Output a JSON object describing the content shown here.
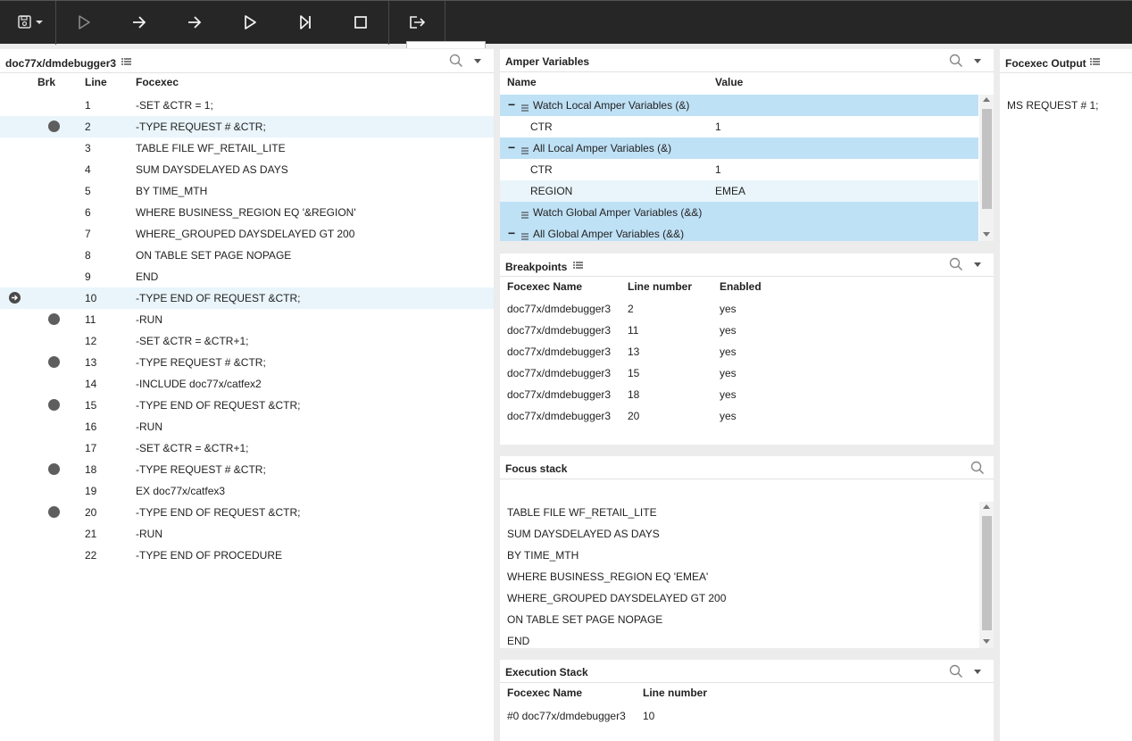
{
  "toolbar": {
    "buttons": [
      {
        "name": "save-menu",
        "icon": "save-icon"
      },
      {
        "name": "run",
        "icon": "play-outline-icon"
      },
      {
        "name": "step-over",
        "icon": "arrow-right-icon"
      },
      {
        "name": "step-into",
        "icon": "arrow-right-icon"
      },
      {
        "name": "continue",
        "icon": "play-icon"
      },
      {
        "name": "step-to-end",
        "icon": "skip-next-icon"
      },
      {
        "name": "stop",
        "icon": "stop-icon"
      },
      {
        "name": "exit",
        "icon": "exit-icon"
      }
    ]
  },
  "source": {
    "title": "doc77x/dmdebugger3",
    "headers": {
      "brk": "Brk",
      "line": "Line",
      "focexec": "Focexec"
    },
    "lines": [
      {
        "num": "1",
        "code": "-SET &CTR = 1;",
        "bp": false,
        "current": false,
        "hl": false
      },
      {
        "num": "2",
        "code": "-TYPE REQUEST # &CTR;",
        "bp": true,
        "current": false,
        "hl": true
      },
      {
        "num": "3",
        "code": "TABLE FILE WF_RETAIL_LITE",
        "bp": false,
        "current": false,
        "hl": false
      },
      {
        "num": "4",
        "code": "SUM DAYSDELAYED AS DAYS",
        "bp": false,
        "current": false,
        "hl": false
      },
      {
        "num": "5",
        "code": "BY TIME_MTH",
        "bp": false,
        "current": false,
        "hl": false
      },
      {
        "num": "6",
        "code": "WHERE BUSINESS_REGION EQ '&REGION'",
        "bp": false,
        "current": false,
        "hl": false
      },
      {
        "num": "7",
        "code": "WHERE_GROUPED DAYSDELAYED GT 200",
        "bp": false,
        "current": false,
        "hl": false
      },
      {
        "num": "8",
        "code": "ON TABLE SET PAGE NOPAGE",
        "bp": false,
        "current": false,
        "hl": false
      },
      {
        "num": "9",
        "code": "END",
        "bp": false,
        "current": false,
        "hl": false
      },
      {
        "num": "10",
        "code": "-TYPE END OF REQUEST &CTR;",
        "bp": false,
        "current": true,
        "hl": true
      },
      {
        "num": "11",
        "code": "-RUN",
        "bp": true,
        "current": false,
        "hl": false
      },
      {
        "num": "12",
        "code": "-SET &CTR = &CTR+1;",
        "bp": false,
        "current": false,
        "hl": false
      },
      {
        "num": "13",
        "code": "-TYPE REQUEST # &CTR;",
        "bp": true,
        "current": false,
        "hl": false
      },
      {
        "num": "14",
        "code": "-INCLUDE doc77x/catfex2",
        "bp": false,
        "current": false,
        "hl": false
      },
      {
        "num": "15",
        "code": "-TYPE END OF REQUEST &CTR;",
        "bp": true,
        "current": false,
        "hl": false
      },
      {
        "num": "16",
        "code": "-RUN",
        "bp": false,
        "current": false,
        "hl": false
      },
      {
        "num": "17",
        "code": "-SET &CTR = &CTR+1;",
        "bp": false,
        "current": false,
        "hl": false
      },
      {
        "num": "18",
        "code": "-TYPE REQUEST # &CTR;",
        "bp": true,
        "current": false,
        "hl": false
      },
      {
        "num": "19",
        "code": "EX doc77x/catfex3",
        "bp": false,
        "current": false,
        "hl": false
      },
      {
        "num": "20",
        "code": "-TYPE END OF REQUEST &CTR;",
        "bp": true,
        "current": false,
        "hl": false
      },
      {
        "num": "21",
        "code": "-RUN",
        "bp": false,
        "current": false,
        "hl": false
      },
      {
        "num": "22",
        "code": "-TYPE END OF PROCEDURE",
        "bp": false,
        "current": false,
        "hl": false
      }
    ]
  },
  "amper": {
    "title": "Amper Variables",
    "headers": {
      "name": "Name",
      "value": "Value"
    },
    "rows": [
      {
        "type": "group",
        "toggle": "−",
        "label": "Watch Local Amper Variables (&)"
      },
      {
        "type": "var",
        "name": "CTR",
        "value": "1",
        "hl": false
      },
      {
        "type": "group",
        "toggle": "−",
        "label": "All Local Amper Variables (&)"
      },
      {
        "type": "var",
        "name": "CTR",
        "value": "1",
        "hl": false
      },
      {
        "type": "var",
        "name": "REGION",
        "value": "EMEA",
        "hl": true
      },
      {
        "type": "group",
        "toggle": "",
        "label": "Watch Global Amper Variables (&&)"
      },
      {
        "type": "group",
        "toggle": "−",
        "label": "All Global Amper Variables (&&)"
      }
    ]
  },
  "breakpoints": {
    "title": "Breakpoints",
    "headers": {
      "name": "Focexec Name",
      "line": "Line number",
      "enabled": "Enabled"
    },
    "rows": [
      {
        "name": "doc77x/dmdebugger3",
        "line": "2",
        "enabled": "yes"
      },
      {
        "name": "doc77x/dmdebugger3",
        "line": "11",
        "enabled": "yes"
      },
      {
        "name": "doc77x/dmdebugger3",
        "line": "13",
        "enabled": "yes"
      },
      {
        "name": "doc77x/dmdebugger3",
        "line": "15",
        "enabled": "yes"
      },
      {
        "name": "doc77x/dmdebugger3",
        "line": "18",
        "enabled": "yes"
      },
      {
        "name": "doc77x/dmdebugger3",
        "line": "20",
        "enabled": "yes"
      }
    ]
  },
  "focus": {
    "title": "Focus stack",
    "lines": [
      "TABLE FILE WF_RETAIL_LITE",
      "SUM DAYSDELAYED AS DAYS",
      "BY TIME_MTH",
      "WHERE BUSINESS_REGION EQ 'EMEA'",
      "WHERE_GROUPED DAYSDELAYED GT 200",
      "ON TABLE SET PAGE NOPAGE",
      "END"
    ]
  },
  "exec": {
    "title": "Execution Stack",
    "headers": {
      "name": "Focexec Name",
      "line": "Line number"
    },
    "rows": [
      {
        "name": "#0 doc77x/dmdebugger3",
        "line": "10"
      }
    ]
  },
  "output": {
    "title": "Focexec Output",
    "text": "MS REQUEST # 1;"
  }
}
